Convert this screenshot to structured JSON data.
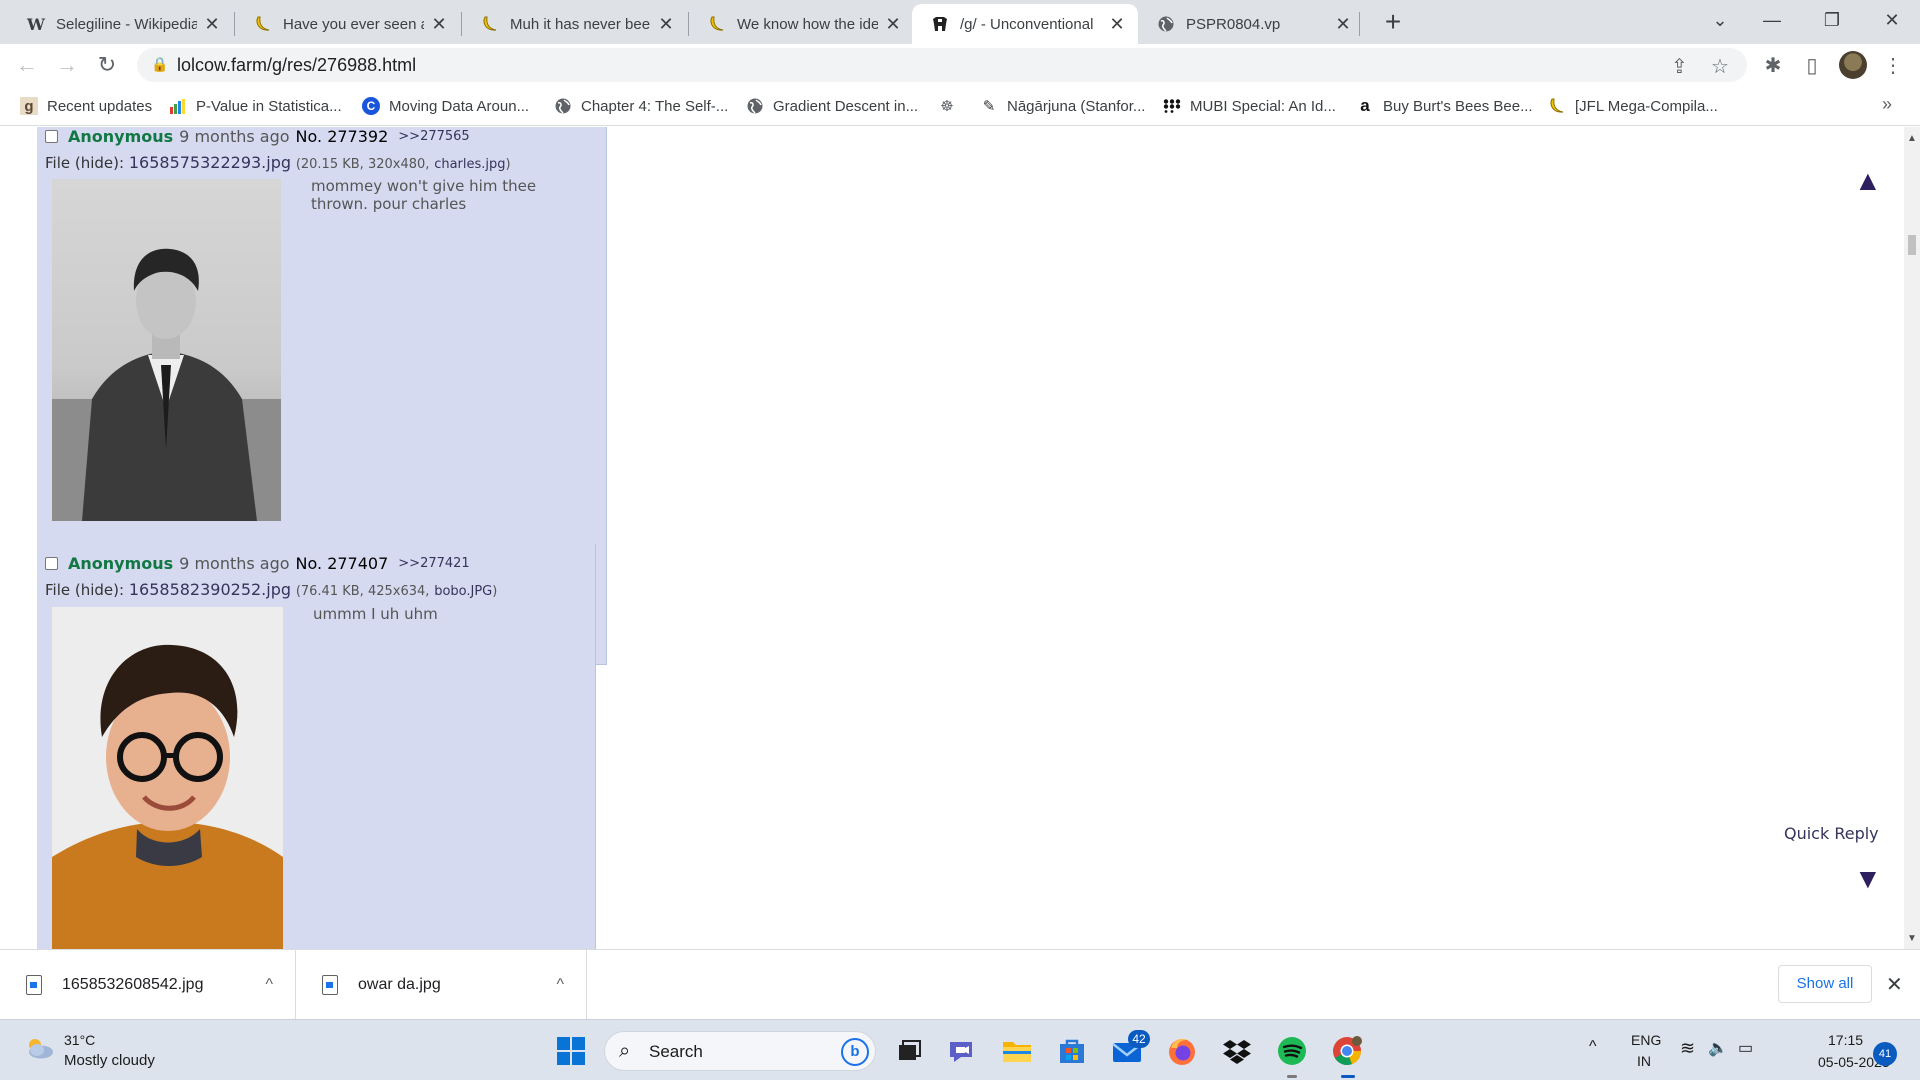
{
  "tabs": [
    {
      "title": "Selegiline - Wikipedia",
      "favicon": "W"
    },
    {
      "title": "Have you ever seen a",
      "favicon": "(("
    },
    {
      "title": "Muh it has never been",
      "favicon": "(("
    },
    {
      "title": "We know how the ide",
      "favicon": "(("
    },
    {
      "title": "/g/ - Unconventional",
      "favicon": "🐄"
    },
    {
      "title": "PSPR0804.vp",
      "favicon": "🌐"
    }
  ],
  "address": {
    "url": "lolcow.farm/g/res/276988.html"
  },
  "bookmarks": [
    {
      "label": "Recent updates",
      "icon": "g"
    },
    {
      "label": "P-Value in Statistica...",
      "icon": "▮"
    },
    {
      "label": "Moving Data Aroun...",
      "icon": "C"
    },
    {
      "label": "Chapter 4: The Self-...",
      "icon": "🌐"
    },
    {
      "label": "Gradient Descent in...",
      "icon": "🌐"
    },
    {
      "label": "",
      "icon": "☸"
    },
    {
      "label": "Nāgārjuna (Stanfor...",
      "icon": "✎"
    },
    {
      "label": "MUBI Special: An Id...",
      "icon": "⁘"
    },
    {
      "label": "Buy Burt's Bees Bee...",
      "icon": "a"
    },
    {
      "label": "[JFL Mega-Compila...",
      "icon": "(("
    }
  ],
  "posts": [
    {
      "name": "Anonymous",
      "time": "9 months ago",
      "no": "No. 277392",
      "backlink": ">>277565",
      "file_prefix": "File (hide):",
      "file_name": "1658575322293.jpg",
      "file_meta_open": "(20.15 KB, 320x480,",
      "file_orig": "charles.jpg",
      "file_meta_close": ")",
      "message_lines": [
        "mommey won't give him thee",
        "thrown. pour charles"
      ]
    },
    {
      "name": "Anonymous",
      "time": "9 months ago",
      "no": "No. 277407",
      "backlink": ">>277421",
      "file_prefix": "File (hide):",
      "file_name": "1658582390252.jpg",
      "file_meta_open": "(76.41 KB, 425x634,",
      "file_orig": "bobo.JPG",
      "file_meta_close": ")",
      "message_lines": [
        "ummm I uh uhm"
      ]
    }
  ],
  "page_nav": {
    "up": "▲",
    "down": "▼",
    "quick_reply": "Quick Reply"
  },
  "downloads": {
    "items": [
      {
        "name": "1658532608542.jpg"
      },
      {
        "name": "owar da.jpg"
      }
    ],
    "show_all": "Show all"
  },
  "taskbar": {
    "weather_temp": "31°C",
    "weather_desc": "Mostly cloudy",
    "search_label": "Search",
    "mail_badge": "42",
    "lang_top": "ENG",
    "lang_bottom": "IN",
    "time": "17:15",
    "date": "05-05-2023",
    "notifications": "41"
  }
}
